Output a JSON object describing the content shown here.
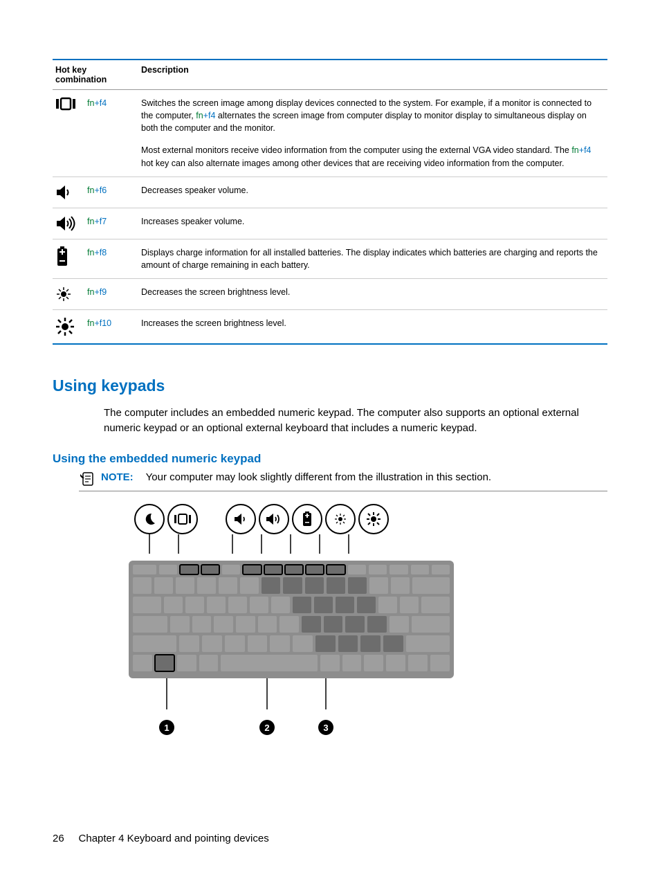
{
  "table": {
    "headers": [
      "Hot key combination",
      "Description"
    ],
    "rows": [
      {
        "icon": "screen-switch",
        "fn": "fn",
        "plus": "+",
        "fkey": "f4",
        "para1_a": "Switches the screen image among display devices connected to the system. For example, if a monitor is connected to the computer, ",
        "para1_b": " alternates the screen image from computer display to monitor display to simultaneous display on both the computer and the monitor.",
        "para2_a": "Most external monitors receive video information from the computer using the external VGA video standard. The ",
        "para2_b": " hot key can also alternate images among other devices that are receiving video information from the computer."
      },
      {
        "icon": "volume-down",
        "fn": "fn",
        "plus": "+",
        "fkey": "f6",
        "desc": "Decreases speaker volume."
      },
      {
        "icon": "volume-up",
        "fn": "fn",
        "plus": "+",
        "fkey": "f7",
        "desc": "Increases speaker volume."
      },
      {
        "icon": "battery",
        "fn": "fn",
        "plus": "+",
        "fkey": "f8",
        "desc": "Displays charge information for all installed batteries. The display indicates which batteries are charging and reports the amount of charge remaining in each battery."
      },
      {
        "icon": "brightness-down",
        "fn": "fn",
        "plus": "+",
        "fkey": "f9",
        "desc": "Decreases the screen brightness level."
      },
      {
        "icon": "brightness-up",
        "fn": "fn",
        "plus": "+",
        "fkey": "f10",
        "desc": "Increases the screen brightness level."
      }
    ]
  },
  "section_title": "Using keypads",
  "section_body": "The computer includes an embedded numeric keypad. The computer also supports an optional external numeric keypad or an optional external keyboard that includes a numeric keypad.",
  "subsection_title": "Using the embedded numeric keypad",
  "note_label": "NOTE:",
  "note_text": "Your computer may look slightly different from the illustration in this section.",
  "footer_page": "26",
  "footer_chapter": "Chapter 4   Keyboard and pointing devices",
  "callouts": [
    "1",
    "2",
    "3"
  ]
}
